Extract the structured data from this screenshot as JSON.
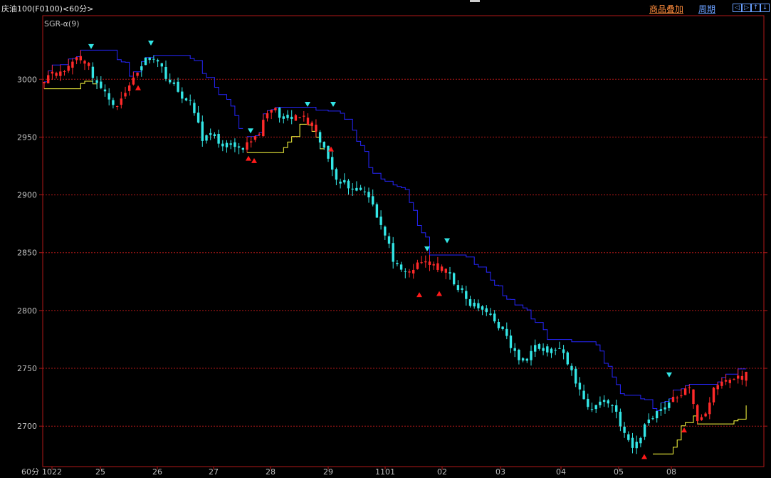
{
  "header": {
    "title": "庆油100(F0100)<60分>",
    "overlay_label": "商品叠加",
    "period_label": "周期",
    "nav_buttons": [
      "◁",
      "▷",
      "↑",
      "↓"
    ]
  },
  "indicator_label": "SGR-α(9)",
  "period_unit": "60分",
  "colors": {
    "background": "#000000",
    "frame": "#b01818",
    "grid": "#b01818",
    "up": "#ff2a2a",
    "down": "#33e6e6",
    "upper_band": "#2626ff",
    "lower_band": "#ffff40",
    "sell_signal": "#33e6e6",
    "buy_signal": "#ff1a1a"
  },
  "chart_data": {
    "type": "candlestick",
    "y_ticks": [
      3000,
      2950,
      2900,
      2850,
      2800,
      2750,
      2700
    ],
    "ylim": [
      2665,
      3055
    ],
    "grid": true,
    "x_labels": [
      "1022",
      "25",
      "26",
      "27",
      "28",
      "29",
      "1101",
      "02",
      "03",
      "04",
      "05",
      "08"
    ],
    "price_path": [
      [
        3000,
        3008,
        3004,
        3012,
        3020,
        3015,
        3002,
        2990,
        2982,
        2978,
        2990,
        3005,
        3015,
        3022,
        3012,
        3000,
        2990,
        2984,
        2975,
        2950,
        2950,
        2946,
        2943,
        2940,
        2937
      ],
      [
        2946,
        2950,
        2962,
        2975,
        2970,
        2963,
        2968,
        2965,
        2956,
        2945,
        2930,
        2915,
        2910,
        2906,
        2905,
        2900,
        2880,
        2862,
        2842,
        2830,
        2834,
        2840,
        2842,
        2838,
        2834,
        2828,
        2818,
        2806,
        2804,
        2800,
        2795,
        2785,
        2772,
        2760,
        2752,
        2775,
        2768,
        2764,
        2768,
        2756,
        2742,
        2725,
        2715,
        2720,
        2722,
        2715,
        2695,
        2680,
        2690,
        2706,
        2712,
        2718,
        2722,
        2728,
        2732,
        2706,
        2712,
        2730,
        2738,
        2740,
        2742,
        2745
      ]
    ],
    "signals": {
      "sell": [
        [
          2,
          3028
        ],
        [
          20,
          3031
        ],
        [
          122,
          2955
        ],
        [
          204,
          2978
        ],
        [
          226,
          2978
        ],
        [
          366,
          2853
        ],
        [
          392,
          2860
        ],
        [
          605,
          2744
        ]
      ],
      "buy": [
        [
          71,
          2993
        ],
        [
          115,
          2932
        ],
        [
          122,
          2930
        ],
        [
          215,
          2940
        ],
        [
          354,
          2814
        ],
        [
          380,
          2815
        ],
        [
          566,
          2674
        ],
        [
          599,
          2697
        ]
      ]
    }
  }
}
